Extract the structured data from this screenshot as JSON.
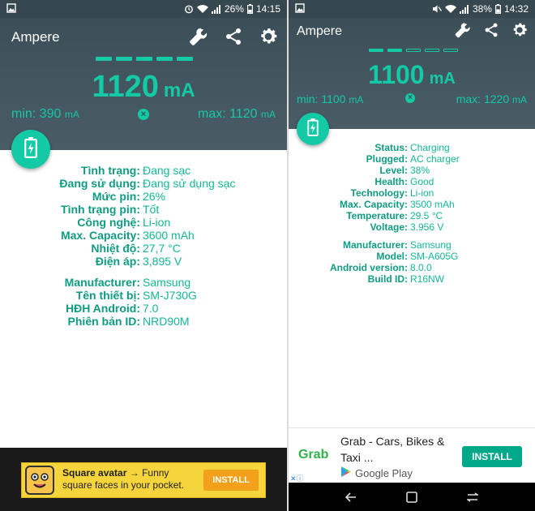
{
  "left": {
    "status_bar": {
      "battery": "26%",
      "time": "14:15"
    },
    "app_title": "Ampere",
    "current_value": "1120",
    "current_unit": "mA",
    "min_label": "min: 390",
    "max_label": "max: 1120",
    "unit_small": "mA",
    "reset_symbol": "×",
    "info": [
      {
        "k": "Tình trạng:",
        "v": "Đang sạc"
      },
      {
        "k": "Đang sử dụng:",
        "v": "Đang sử dụng sạc"
      },
      {
        "k": "Mức pin:",
        "v": "26%"
      },
      {
        "k": "Tình trạng pin:",
        "v": "Tốt"
      },
      {
        "k": "Công nghệ:",
        "v": "Li-ion"
      },
      {
        "k": "Max. Capacity:",
        "v": "3600 mAh"
      },
      {
        "k": "Nhiệt độ:",
        "v": "27,7 °C"
      },
      {
        "k": "Điện áp:",
        "v": "3,895 V"
      }
    ],
    "device": [
      {
        "k": "Manufacturer:",
        "v": "Samsung"
      },
      {
        "k": "Tên thiết bị:",
        "v": "SM-J730G"
      },
      {
        "k": "HĐH Android:",
        "v": "7.0"
      },
      {
        "k": "Phiên bản ID:",
        "v": "NRD90M"
      }
    ],
    "ad": {
      "title": "Square avatar",
      "arrow": "→",
      "text": "Funny square faces in your pocket.",
      "install": "INSTALL"
    }
  },
  "right": {
    "status_bar": {
      "battery": "38%",
      "time": "14:32"
    },
    "app_title": "Ampere",
    "current_value": "1100",
    "current_unit": "mA",
    "min_label": "min: 1100",
    "max_label": "max: 1220",
    "unit_small": "mA",
    "reset_symbol": "×",
    "info": [
      {
        "k": "Status:",
        "v": "Charging"
      },
      {
        "k": "Plugged:",
        "v": "AC charger"
      },
      {
        "k": "Level:",
        "v": "38%"
      },
      {
        "k": "Health:",
        "v": "Good"
      },
      {
        "k": "Technology:",
        "v": "Li-ion"
      },
      {
        "k": "Max. Capacity:",
        "v": "3500 mAh"
      },
      {
        "k": "Temperature:",
        "v": "29.5 °C"
      },
      {
        "k": "Voltage:",
        "v": "3.956 V"
      }
    ],
    "device": [
      {
        "k": "Manufacturer:",
        "v": "Samsung"
      },
      {
        "k": "Model:",
        "v": "SM-A605G"
      },
      {
        "k": "Android version:",
        "v": "8.0.0"
      },
      {
        "k": "Build ID:",
        "v": "R16NW"
      }
    ],
    "ad": {
      "logo": "Grab",
      "title": "Grab - Cars, Bikes & Taxi ...",
      "store": "Google Play",
      "install": "INSTALL",
      "adchoice": "✕ⓘ"
    }
  },
  "colors": {
    "accent": "#14c9a6",
    "header": "#3c4e58",
    "label": "#0f9c82"
  },
  "icons": [
    "wrench-icon",
    "share-icon",
    "gear-icon",
    "battery-charging-icon",
    "wifi-icon",
    "signal-icon",
    "battery-icon",
    "mute-icon",
    "image-icon",
    "back-icon",
    "recents-icon",
    "home-icon"
  ]
}
